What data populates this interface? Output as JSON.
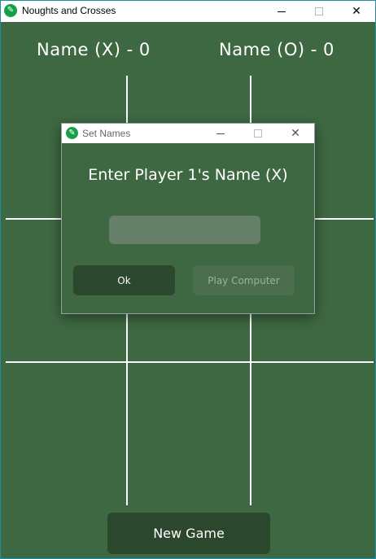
{
  "window": {
    "title": "Noughts and Crosses",
    "controls": {
      "minimize": "—",
      "maximize": "☐",
      "close": "✕"
    }
  },
  "scores": {
    "player_x": "Name (X) - 0",
    "player_o": "Name (O) - 0"
  },
  "board": {
    "cells": [
      "",
      "",
      "",
      "",
      "",
      "",
      "",
      "",
      ""
    ]
  },
  "new_game_label": "New Game",
  "dialog": {
    "title": "Set Names",
    "prompt": "Enter Player 1's Name (X)",
    "name_input": {
      "value": "",
      "placeholder": ""
    },
    "ok_label": "Ok",
    "play_computer_label": "Play Computer"
  },
  "colors": {
    "background": "#3e6842",
    "button_dark": "#2b472e",
    "input_bg": "#657f69",
    "accent_icon": "#17a04a"
  },
  "icons": {
    "app": "noughts-crosses-app-icon",
    "close": "close-icon"
  }
}
